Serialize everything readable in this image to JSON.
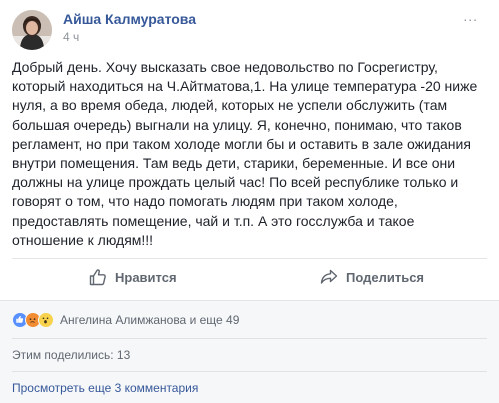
{
  "post": {
    "author": "Айша Калмуратова",
    "time": "4 ч",
    "more": "...",
    "text": "Добрый день. Хочу высказать свое недовольство по Госрегистру, который находиться на Ч.Айтматова,1. На улице температура -20 ниже нуля, а во время обеда, людей, которых не успели обслужить (там большая очередь) выгнали на улицу. Я, конечно, понимаю, что таков регламент, но при таком холоде могли бы и оставить в зале ожидания внутри помещения. Там ведь дети, старики, беременные. И все они должны на улице прождать целый час! По всей республике только и говорят о том, что надо помогать людям при таком холоде, предоставлять помещение, чай и т.п. А это госслужба и такое отношение к людям!!!"
  },
  "actions": {
    "like": "Нравится",
    "share": "Поделиться"
  },
  "footer": {
    "reactions": "Ангелина Алимжанова и еще 49",
    "reaction_icons": [
      "like-icon",
      "angry-icon",
      "wow-icon"
    ],
    "shares": "Этим поделились: 13",
    "view_more": "Просмотреть еще 3 комментария"
  },
  "colors": {
    "link": "#365899",
    "muted": "#90949c",
    "like_blue": "#5890ff"
  }
}
